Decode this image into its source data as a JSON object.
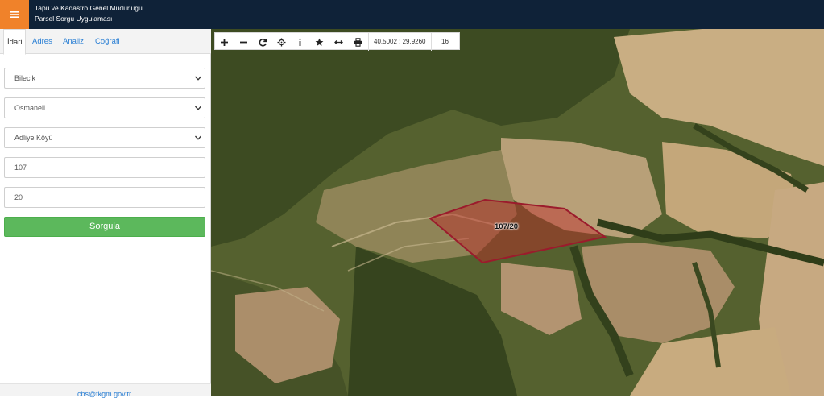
{
  "header": {
    "title_line1": "Tapu ve Kadastro Genel Müdürlüğü",
    "title_line2": "Parsel Sorgu Uygulaması",
    "menu_icon": "hamburger-icon"
  },
  "tabs": [
    {
      "label": "İdari"
    },
    {
      "label": "Adres"
    },
    {
      "label": "Analiz"
    },
    {
      "label": "Coğrafi"
    }
  ],
  "form": {
    "province": "Bilecik",
    "district": "Osmaneli",
    "neighborhood": "Adliye Köyü",
    "block": "107",
    "parcel": "20",
    "submit_label": "Sorgula"
  },
  "footer": {
    "link": "cbs@tkgm.gov.tr"
  },
  "map": {
    "coordinates": "40.5002 : 29.9260",
    "zoom": "16",
    "parcel_label": "107/20",
    "tools": [
      "zoom-in-icon",
      "zoom-out-icon",
      "refresh-icon",
      "locate-icon",
      "info-icon",
      "star-icon",
      "measure-icon",
      "print-icon"
    ]
  },
  "colors": {
    "topbar": "#0f2238",
    "menu_button": "#f0822a",
    "submit_button": "#5cb85c",
    "parcel_stroke": "#9b1b2c"
  }
}
